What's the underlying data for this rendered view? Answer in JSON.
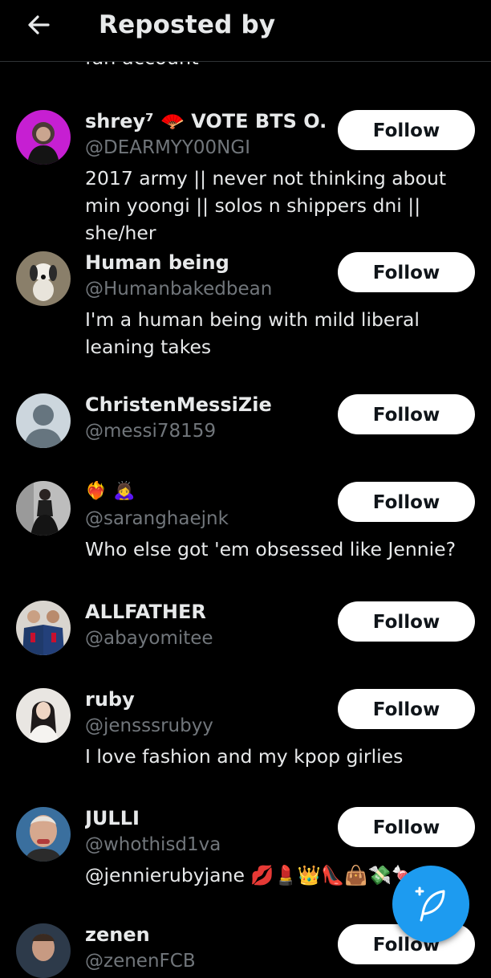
{
  "header": {
    "title": "Reposted by"
  },
  "peek": {
    "bio": "fan account"
  },
  "users": [
    {
      "name": "shrey⁷ 🪭 VOTE BTS O...",
      "handle": "@DEARMYY00NGI",
      "bio": "2017 army || never not thinking about min yoongi || solos n shippers dni || she/her",
      "follow_label": "Follow"
    },
    {
      "name": "Human being",
      "handle": "@Humanbakedbean",
      "bio": "I'm a human being with mild liberal leaning takes",
      "follow_label": "Follow"
    },
    {
      "name": "ChristenMessiZie",
      "handle": "@messi78159",
      "bio": "",
      "follow_label": "Follow"
    },
    {
      "name": "❤️‍🔥 🙇‍♀️",
      "handle": "@saranghaejnk",
      "bio": "Who else got 'em obsessed like Jennie?",
      "follow_label": "Follow"
    },
    {
      "name": "ALLFATHER",
      "handle": "@abayomitee",
      "bio": "",
      "follow_label": "Follow"
    },
    {
      "name": "ruby",
      "handle": "@jensssrubyy",
      "bio": "I love fashion and my kpop girlies",
      "follow_label": "Follow"
    },
    {
      "name": "JULLI",
      "handle": "@whothisd1va",
      "bio": "@jennierubyjane 💋💄👑👠👜💸🍬",
      "follow_label": "Follow"
    },
    {
      "name": "zenen",
      "handle": "@zenenFCB",
      "bio": "",
      "follow_label": "Follow"
    }
  ],
  "icons": {
    "back": "arrow-left-icon",
    "compose": "feather-plus-icon"
  },
  "colors": {
    "background": "#000000",
    "text": "#e7e9ea",
    "secondary": "#71767b",
    "accent": "#1d9bf0",
    "button_bg": "#ffffff"
  }
}
